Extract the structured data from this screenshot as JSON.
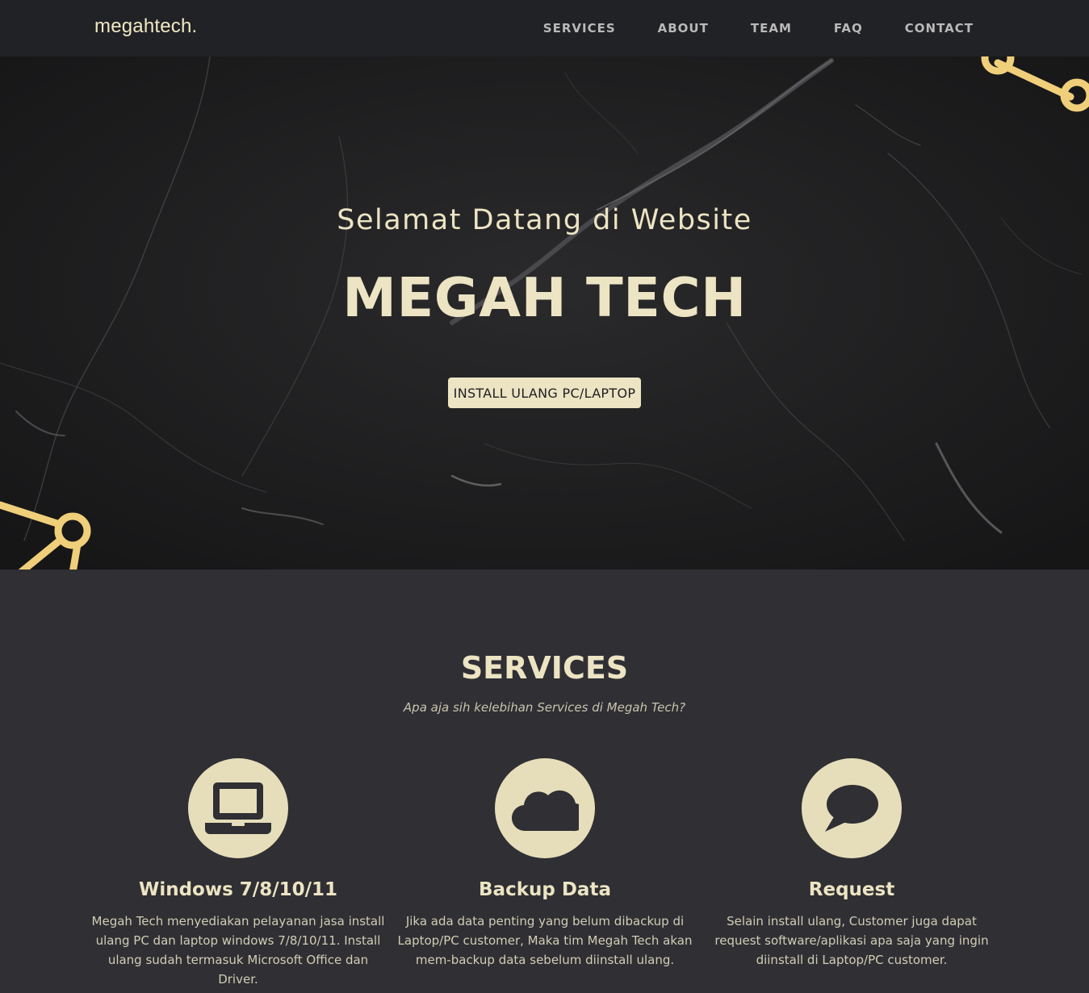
{
  "nav": {
    "brand": "megahtech.",
    "links": [
      {
        "label": "SERVICES"
      },
      {
        "label": "ABOUT"
      },
      {
        "label": "TEAM"
      },
      {
        "label": "FAQ"
      },
      {
        "label": "CONTACT"
      }
    ]
  },
  "hero": {
    "subtitle": "Selamat Datang di Website",
    "title": "MEGAH TECH",
    "button_label": "INSTALL ULANG PC/LAPTOP"
  },
  "services": {
    "heading": "SERVICES",
    "subheading": "Apa aja sih kelebihan Services di Megah Tech?",
    "items": [
      {
        "icon": "laptop-icon",
        "title": "Windows 7/8/10/11",
        "description": "Megah Tech menyediakan pelayanan jasa install ulang PC dan laptop windows 7/8/10/11. Install ulang sudah termasuk Microsoft Office dan Driver."
      },
      {
        "icon": "cloud-icon",
        "title": "Backup Data",
        "description": "Jika ada data penting yang belum dibackup di Laptop/PC customer, Maka tim Megah Tech akan mem-backup data sebelum diinstall ulang."
      },
      {
        "icon": "chat-bubble-icon",
        "title": "Request",
        "description": "Selain install ulang, Customer juga dapat request software/aplikasi apa saja yang ingin diinstall di Laptop/PC customer."
      }
    ]
  },
  "colors": {
    "accent": "#ece4c3",
    "navbar_bg": "#212226",
    "section_bg": "#2f2f34"
  }
}
